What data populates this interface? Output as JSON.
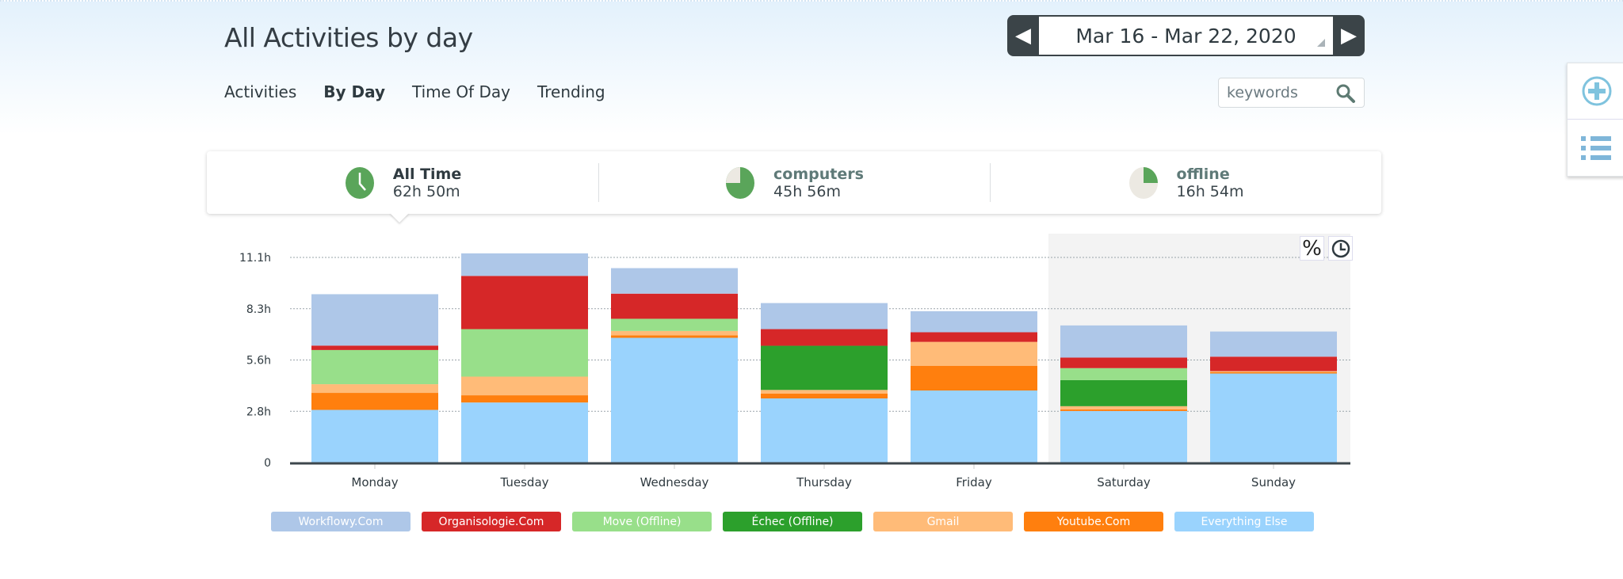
{
  "header": {
    "title": "All Activities by day",
    "date_range": "Mar 16 - Mar 22, 2020",
    "tabs": [
      {
        "label": "Activities",
        "active": false
      },
      {
        "label": "By Day",
        "active": true
      },
      {
        "label": "Time Of Day",
        "active": false
      },
      {
        "label": "Trending",
        "active": false
      }
    ],
    "search_placeholder": "keywords"
  },
  "side_panel": {
    "icons": [
      "plus-circle-icon",
      "list-icon"
    ]
  },
  "summary": [
    {
      "label": "All Time",
      "value": "62h 50m",
      "icon": "clock-icon"
    },
    {
      "label": "computers",
      "value": "45h 56m",
      "icon": "pie-icon",
      "fraction": 0.73
    },
    {
      "label": "offline",
      "value": "16h 54m",
      "icon": "pie-icon",
      "fraction": 0.27
    }
  ],
  "chart_controls": {
    "percent": "%",
    "time": "clock-icon"
  },
  "chart_data": {
    "type": "bar",
    "stacked": true,
    "categories": [
      "Monday",
      "Tuesday",
      "Wednesday",
      "Thursday",
      "Friday",
      "Saturday",
      "Sunday"
    ],
    "yticks": [
      "0",
      "2.8h",
      "5.6h",
      "8.3h",
      "11.1h"
    ],
    "ytick_values": [
      0,
      2.775,
      5.55,
      8.325,
      11.1
    ],
    "ylim": [
      0,
      11.1
    ],
    "yunit": "hours",
    "grid": true,
    "highlighted_categories": [
      "Saturday",
      "Sunday"
    ],
    "legend_position": "bottom",
    "series": [
      {
        "name": "Everything Else",
        "color": "#9ad3fd",
        "values": [
          2.85,
          3.25,
          6.75,
          3.47,
          3.9,
          2.79,
          4.82
        ]
      },
      {
        "name": "Youtube.Com",
        "color": "#ff7f0e",
        "values": [
          0.92,
          0.39,
          0.13,
          0.26,
          1.34,
          0.09,
          0.07
        ]
      },
      {
        "name": "Gmail",
        "color": "#ffbb78",
        "values": [
          0.47,
          1.01,
          0.24,
          0.2,
          1.29,
          0.17,
          0.06
        ]
      },
      {
        "name": "Échec (Offline)",
        "color": "#2ca02c",
        "values": [
          0,
          0,
          0,
          2.39,
          0,
          1.41,
          0
        ]
      },
      {
        "name": "Move (Offline)",
        "color": "#98df8a",
        "values": [
          1.85,
          2.57,
          0.66,
          0,
          0,
          0.65,
          0
        ]
      },
      {
        "name": "Organisologie.Com",
        "color": "#d62728",
        "values": [
          0.24,
          2.88,
          1.36,
          0.9,
          0.52,
          0.57,
          0.78
        ]
      },
      {
        "name": "Workflowy.Com",
        "color": "#aec7e8",
        "values": [
          2.78,
          1.22,
          1.38,
          1.41,
          1.14,
          1.74,
          1.36
        ]
      }
    ],
    "legend_order": [
      "Workflowy.Com",
      "Organisologie.Com",
      "Move (Offline)",
      "Échec (Offline)",
      "Gmail",
      "Youtube.Com",
      "Everything Else"
    ]
  }
}
